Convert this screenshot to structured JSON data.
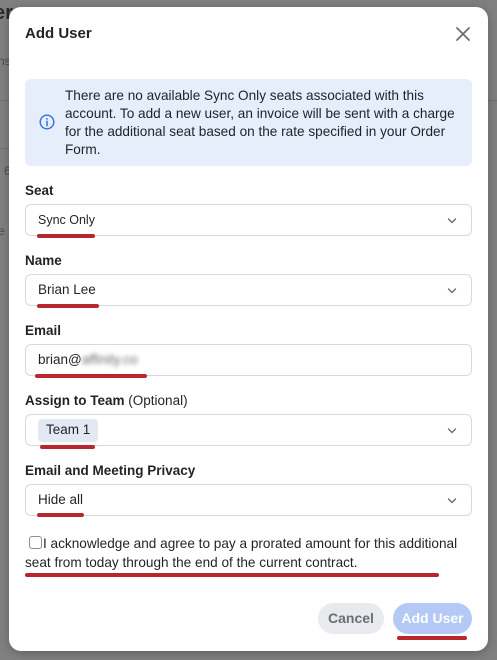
{
  "background": {
    "title_fragment": "er",
    "left_fragments": [
      "ns",
      "6",
      "e"
    ]
  },
  "modal": {
    "title": "Add User"
  },
  "notice": {
    "icon": "info-icon",
    "text": "There are no available Sync Only seats associated with this account. To add a new user, an invoice will be sent with a charge for the additional seat based on the rate specified in your Order Form."
  },
  "fields": {
    "seat": {
      "label": "Seat",
      "value": "Sync Only"
    },
    "name": {
      "label": "Name",
      "value": "Brian Lee"
    },
    "email": {
      "label": "Email",
      "value_visible": "brian@",
      "value_blurred": "affinity.co"
    },
    "team": {
      "label": "Assign to Team",
      "optional": "(Optional)",
      "value": "Team 1"
    },
    "privacy": {
      "label": "Email and Meeting Privacy",
      "value": "Hide all"
    }
  },
  "acknowledgement": {
    "checked": false,
    "text": "I acknowledge and agree to pay a prorated amount for this additional seat from today through the end of the current contract."
  },
  "buttons": {
    "cancel": "Cancel",
    "add_user": "Add User"
  },
  "colors": {
    "notice_bg": "#e6edfb",
    "primary_disabled": "#b4c9f5",
    "annotation_red": "#b8272e",
    "info_blue": "#2f6fe4"
  }
}
